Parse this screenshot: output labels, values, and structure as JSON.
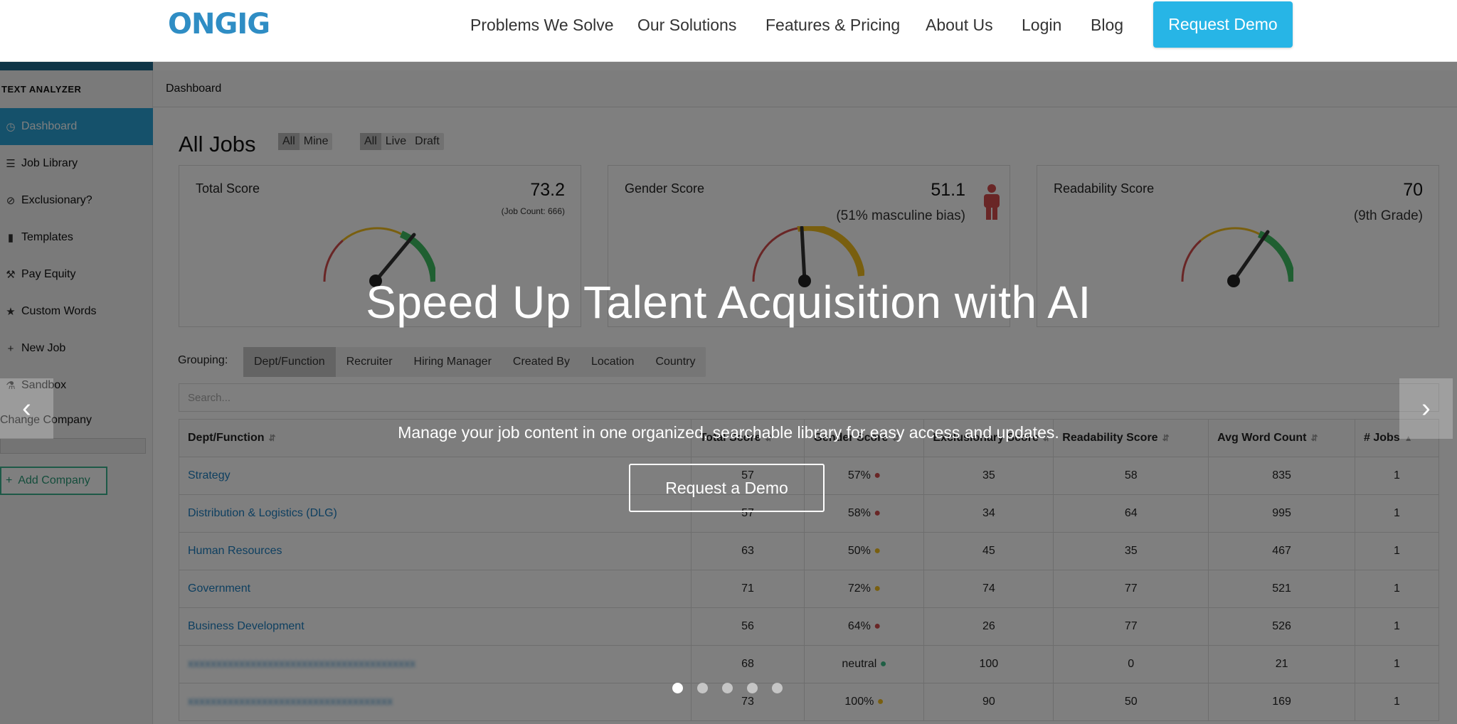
{
  "nav": {
    "logo": "ONGIG",
    "links": [
      "Problems We Solve",
      "Our Solutions",
      "Features & Pricing",
      "About Us",
      "Login",
      "Blog"
    ],
    "cta": "Request Demo"
  },
  "sidebar": {
    "title": "TEXT ANALYZER",
    "items": [
      {
        "label": "Dashboard",
        "icon": "dashboard-icon"
      },
      {
        "label": "Job Library",
        "icon": "list-icon"
      },
      {
        "label": "Exclusionary?",
        "icon": "ban-icon"
      },
      {
        "label": "Templates",
        "icon": "file-icon"
      },
      {
        "label": "Pay Equity",
        "icon": "gavel-icon"
      },
      {
        "label": "Custom Words",
        "icon": "trophy-icon"
      },
      {
        "label": "New Job",
        "icon": "plus-icon"
      },
      {
        "label": "Sandbox",
        "icon": "flask-icon"
      }
    ],
    "change_company": "Change Company",
    "add_company": "Add Company"
  },
  "breadcrumb": "Dashboard",
  "page": {
    "title": "All Jobs",
    "owner_filters": [
      "All",
      "Mine"
    ],
    "status_filters": [
      "All",
      "Live",
      "Draft"
    ]
  },
  "cards": [
    {
      "title": "Total Score",
      "score": "73.2",
      "sub": "(Job Count: 666)"
    },
    {
      "title": "Gender Score",
      "score": "51.1",
      "sub": "(51% masculine bias)"
    },
    {
      "title": "Readability Score",
      "score": "70",
      "sub": "(9th Grade)"
    }
  ],
  "grouping": {
    "label": "Grouping:",
    "tabs": [
      "Dept/Function",
      "Recruiter",
      "Hiring Manager",
      "Created By",
      "Location",
      "Country"
    ]
  },
  "search_placeholder": "Search...",
  "table": {
    "headers": [
      "Dept/Function",
      "Total Score",
      "Gender Score",
      "Exclusionary Score",
      "Readability Score",
      "Avg Word Count",
      "# Jobs"
    ],
    "rows": [
      [
        "Strategy",
        "57",
        "57%",
        "35",
        "58",
        "835",
        "1"
      ],
      [
        "Distribution & Logistics (DLG)",
        "57",
        "58%",
        "34",
        "64",
        "995",
        "1"
      ],
      [
        "Human Resources",
        "63",
        "50%",
        "45",
        "35",
        "467",
        "1"
      ],
      [
        "Government",
        "71",
        "72%",
        "74",
        "77",
        "521",
        "1"
      ],
      [
        "Business Development",
        "56",
        "64%",
        "26",
        "77",
        "526",
        "1"
      ],
      [
        "",
        "68",
        "neutral",
        "100",
        "0",
        "21",
        "1"
      ],
      [
        "",
        "73",
        "100%",
        "90",
        "50",
        "169",
        "1"
      ]
    ]
  },
  "hero": {
    "title": "Speed Up Talent Acquisition with AI",
    "subtitle": "Manage your job content in one organized, searchable library for easy access and updates.",
    "cta": "Request a Demo",
    "slide_count": 5,
    "active_slide": 1
  },
  "colors": {
    "brand": "#2f8dc4",
    "cta": "#27b5e6",
    "gauge_red": "#d24d4d",
    "gauge_yellow": "#f3bf1f",
    "gauge_green": "#3fbf62"
  }
}
